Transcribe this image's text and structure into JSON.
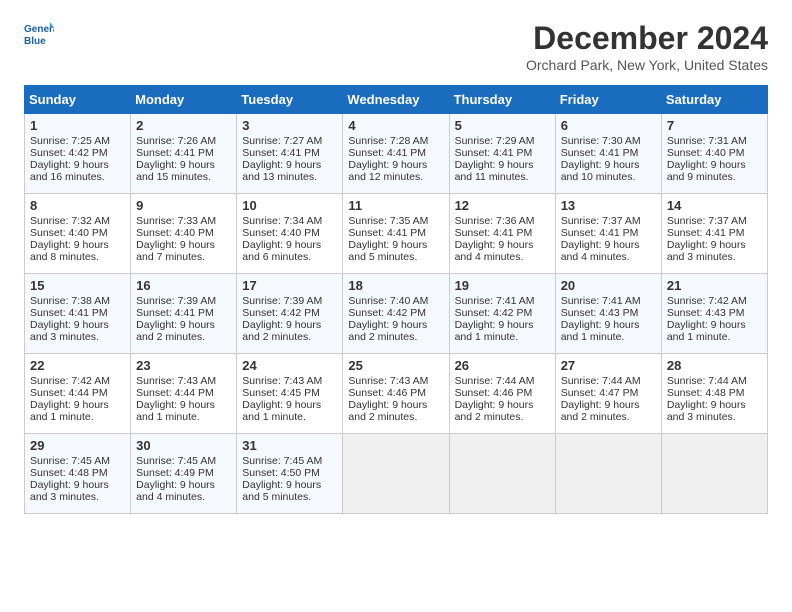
{
  "header": {
    "logo_line1": "General",
    "logo_line2": "Blue",
    "month": "December 2024",
    "location": "Orchard Park, New York, United States"
  },
  "days_of_week": [
    "Sunday",
    "Monday",
    "Tuesday",
    "Wednesday",
    "Thursday",
    "Friday",
    "Saturday"
  ],
  "weeks": [
    [
      {
        "day": "1",
        "sunrise": "7:25 AM",
        "sunset": "4:42 PM",
        "daylight": "9 hours and 16 minutes."
      },
      {
        "day": "2",
        "sunrise": "7:26 AM",
        "sunset": "4:41 PM",
        "daylight": "9 hours and 15 minutes."
      },
      {
        "day": "3",
        "sunrise": "7:27 AM",
        "sunset": "4:41 PM",
        "daylight": "9 hours and 13 minutes."
      },
      {
        "day": "4",
        "sunrise": "7:28 AM",
        "sunset": "4:41 PM",
        "daylight": "9 hours and 12 minutes."
      },
      {
        "day": "5",
        "sunrise": "7:29 AM",
        "sunset": "4:41 PM",
        "daylight": "9 hours and 11 minutes."
      },
      {
        "day": "6",
        "sunrise": "7:30 AM",
        "sunset": "4:41 PM",
        "daylight": "9 hours and 10 minutes."
      },
      {
        "day": "7",
        "sunrise": "7:31 AM",
        "sunset": "4:40 PM",
        "daylight": "9 hours and 9 minutes."
      }
    ],
    [
      {
        "day": "8",
        "sunrise": "7:32 AM",
        "sunset": "4:40 PM",
        "daylight": "9 hours and 8 minutes."
      },
      {
        "day": "9",
        "sunrise": "7:33 AM",
        "sunset": "4:40 PM",
        "daylight": "9 hours and 7 minutes."
      },
      {
        "day": "10",
        "sunrise": "7:34 AM",
        "sunset": "4:40 PM",
        "daylight": "9 hours and 6 minutes."
      },
      {
        "day": "11",
        "sunrise": "7:35 AM",
        "sunset": "4:41 PM",
        "daylight": "9 hours and 5 minutes."
      },
      {
        "day": "12",
        "sunrise": "7:36 AM",
        "sunset": "4:41 PM",
        "daylight": "9 hours and 4 minutes."
      },
      {
        "day": "13",
        "sunrise": "7:37 AM",
        "sunset": "4:41 PM",
        "daylight": "9 hours and 4 minutes."
      },
      {
        "day": "14",
        "sunrise": "7:37 AM",
        "sunset": "4:41 PM",
        "daylight": "9 hours and 3 minutes."
      }
    ],
    [
      {
        "day": "15",
        "sunrise": "7:38 AM",
        "sunset": "4:41 PM",
        "daylight": "9 hours and 3 minutes."
      },
      {
        "day": "16",
        "sunrise": "7:39 AM",
        "sunset": "4:41 PM",
        "daylight": "9 hours and 2 minutes."
      },
      {
        "day": "17",
        "sunrise": "7:39 AM",
        "sunset": "4:42 PM",
        "daylight": "9 hours and 2 minutes."
      },
      {
        "day": "18",
        "sunrise": "7:40 AM",
        "sunset": "4:42 PM",
        "daylight": "9 hours and 2 minutes."
      },
      {
        "day": "19",
        "sunrise": "7:41 AM",
        "sunset": "4:42 PM",
        "daylight": "9 hours and 1 minute."
      },
      {
        "day": "20",
        "sunrise": "7:41 AM",
        "sunset": "4:43 PM",
        "daylight": "9 hours and 1 minute."
      },
      {
        "day": "21",
        "sunrise": "7:42 AM",
        "sunset": "4:43 PM",
        "daylight": "9 hours and 1 minute."
      }
    ],
    [
      {
        "day": "22",
        "sunrise": "7:42 AM",
        "sunset": "4:44 PM",
        "daylight": "9 hours and 1 minute."
      },
      {
        "day": "23",
        "sunrise": "7:43 AM",
        "sunset": "4:44 PM",
        "daylight": "9 hours and 1 minute."
      },
      {
        "day": "24",
        "sunrise": "7:43 AM",
        "sunset": "4:45 PM",
        "daylight": "9 hours and 1 minute."
      },
      {
        "day": "25",
        "sunrise": "7:43 AM",
        "sunset": "4:46 PM",
        "daylight": "9 hours and 2 minutes."
      },
      {
        "day": "26",
        "sunrise": "7:44 AM",
        "sunset": "4:46 PM",
        "daylight": "9 hours and 2 minutes."
      },
      {
        "day": "27",
        "sunrise": "7:44 AM",
        "sunset": "4:47 PM",
        "daylight": "9 hours and 2 minutes."
      },
      {
        "day": "28",
        "sunrise": "7:44 AM",
        "sunset": "4:48 PM",
        "daylight": "9 hours and 3 minutes."
      }
    ],
    [
      {
        "day": "29",
        "sunrise": "7:45 AM",
        "sunset": "4:48 PM",
        "daylight": "9 hours and 3 minutes."
      },
      {
        "day": "30",
        "sunrise": "7:45 AM",
        "sunset": "4:49 PM",
        "daylight": "9 hours and 4 minutes."
      },
      {
        "day": "31",
        "sunrise": "7:45 AM",
        "sunset": "4:50 PM",
        "daylight": "9 hours and 5 minutes."
      },
      null,
      null,
      null,
      null
    ]
  ]
}
